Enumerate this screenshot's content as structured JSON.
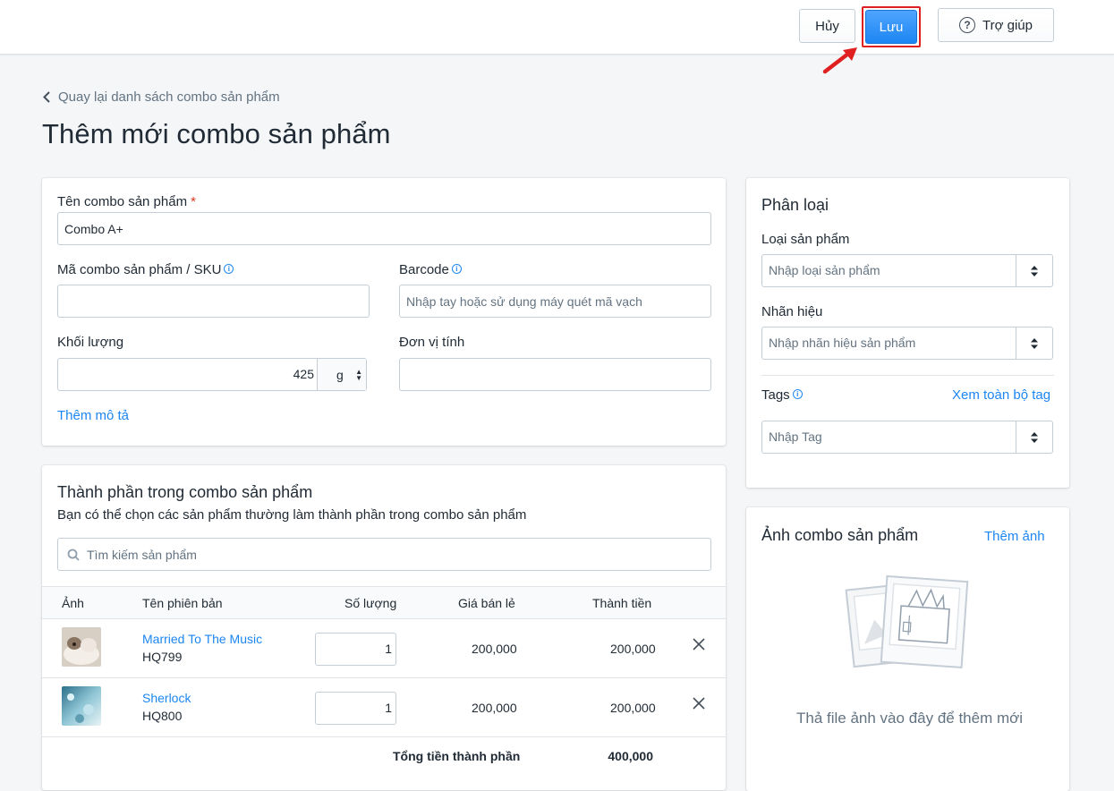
{
  "header": {
    "cancel_label": "Hủy",
    "save_label": "Lưu",
    "help_label": "Trợ giúp"
  },
  "back_label": "Quay lại danh sách combo sản phẩm",
  "page_title": "Thêm mới combo sản phẩm",
  "form": {
    "name_label": "Tên combo sản phẩm",
    "name_value": "Combo A+",
    "sku_label": "Mã combo sản phẩm / SKU",
    "sku_value": "",
    "barcode_label": "Barcode",
    "barcode_placeholder": "Nhập tay hoặc sử dụng máy quét mã vạch",
    "weight_label": "Khối lượng",
    "weight_value": "425",
    "weight_unit": "g",
    "unit_label": "Đơn vị tính",
    "unit_value": "",
    "add_description": "Thêm mô tả"
  },
  "components": {
    "title": "Thành phần trong combo sản phẩm",
    "subtitle": "Bạn có thể chọn các sản phẩm thường làm thành phần trong combo sản phẩm",
    "search_placeholder": "Tìm kiếm sản phẩm",
    "columns": [
      "Ảnh",
      "Tên phiên bản",
      "Số lượng",
      "Giá bán lẻ",
      "Thành tiền"
    ],
    "rows": [
      {
        "name": "Married To The Music",
        "sku": "HQ799",
        "qty": "1",
        "price": "200,000",
        "total": "200,000"
      },
      {
        "name": "Sherlock",
        "sku": "HQ800",
        "qty": "1",
        "price": "200,000",
        "total": "200,000"
      }
    ],
    "total_label": "Tổng tiền thành phần",
    "total_value": "400,000"
  },
  "classification": {
    "title": "Phân loại",
    "type_label": "Loại sản phẩm",
    "type_placeholder": "Nhập loại sản phẩm",
    "brand_label": "Nhãn hiệu",
    "brand_placeholder": "Nhập nhãn hiệu sản phẩm",
    "tags_label": "Tags",
    "view_all_tags": "Xem toàn bộ tag",
    "tags_placeholder": "Nhập Tag"
  },
  "images": {
    "title": "Ảnh combo sản phẩm",
    "add_label": "Thêm ảnh",
    "drop_text": "Thả file ảnh vào đây để thêm mới"
  },
  "colors": {
    "primary": "#1c86f2",
    "highlight": "#e02020"
  }
}
